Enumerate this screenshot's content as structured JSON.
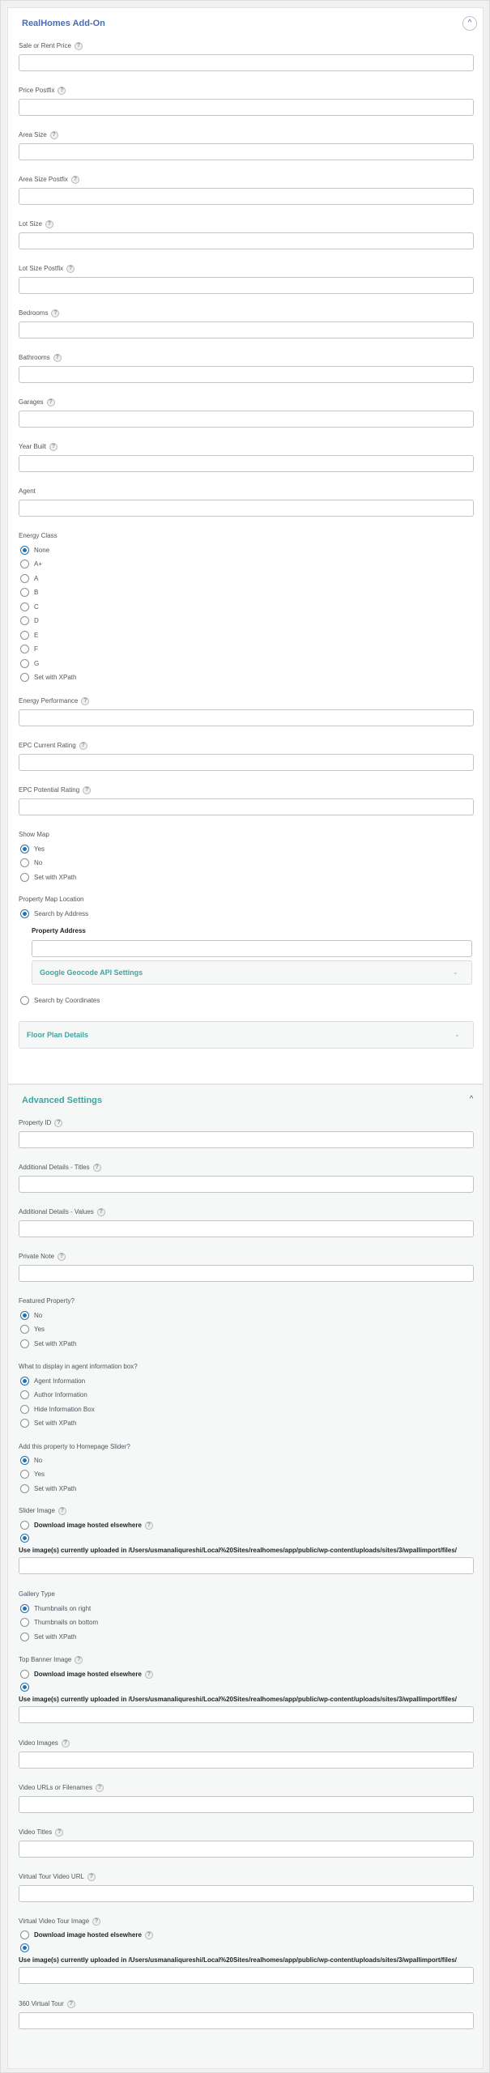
{
  "realhomes": {
    "title": "RealHomes Add-On",
    "fields": [
      {
        "label": "Sale or Rent Price"
      },
      {
        "label": "Price Postfix"
      },
      {
        "label": "Area Size"
      },
      {
        "label": "Area Size Postfix"
      },
      {
        "label": "Lot Size"
      },
      {
        "label": "Lot Size Postfix"
      },
      {
        "label": "Bedrooms"
      },
      {
        "label": "Bathrooms"
      },
      {
        "label": "Garages"
      },
      {
        "label": "Year Built"
      },
      {
        "label": "Agent"
      }
    ],
    "energy_class": {
      "label": "Energy Class",
      "options": [
        "None",
        "A+",
        "A",
        "B",
        "C",
        "D",
        "E",
        "F",
        "G",
        "Set with XPath"
      ],
      "selected": "None"
    },
    "fields2": [
      {
        "label": "Energy Performance"
      },
      {
        "label": "EPC Current Rating"
      },
      {
        "label": "EPC Potential Rating"
      }
    ],
    "show_map": {
      "label": "Show Map",
      "options": [
        "Yes",
        "No",
        "Set with XPath"
      ],
      "selected": "Yes"
    },
    "map_location": {
      "label": "Property Map Location",
      "opt_address": "Search by Address",
      "address_label": "Property Address",
      "geocode_title": "Google Geocode API Settings",
      "opt_coordinates": "Search by Coordinates",
      "selected": "Search by Address"
    },
    "floor_plan_title": "Floor Plan Details"
  },
  "advanced": {
    "title": "Advanced Settings",
    "fields": [
      {
        "label": "Property ID"
      },
      {
        "label": "Additional Details - Titles"
      },
      {
        "label": "Additional Details - Values"
      },
      {
        "label": "Private Note"
      }
    ],
    "featured": {
      "label": "Featured Property?",
      "options": [
        "No",
        "Yes",
        "Set with XPath"
      ],
      "selected": "No"
    },
    "agent_box": {
      "label": "What to display in agent information box?",
      "options": [
        "Agent Information",
        "Author Information",
        "Hide Information Box",
        "Set with XPath"
      ],
      "selected": "Agent Information"
    },
    "homepage_slider": {
      "label": "Add this property to Homepage Slider?",
      "options": [
        "No",
        "Yes",
        "Set with XPath"
      ],
      "selected": "No"
    },
    "slider_image": {
      "label": "Slider Image",
      "opt_download": "Download image hosted elsewhere",
      "opt_use": "Use image(s) currently uploaded in /Users/usmanaliqureshi/Local%20Sites/realhomes/app/public/wp-content/uploads/sites/3/wpallimport/files/"
    },
    "gallery_type": {
      "label": "Gallery Type",
      "options": [
        "Thumbnails on right",
        "Thumbnails on bottom",
        "Set with XPath"
      ],
      "selected": "Thumbnails on right"
    },
    "top_banner": {
      "label": "Top Banner Image",
      "opt_download": "Download image hosted elsewhere",
      "opt_use": "Use image(s) currently uploaded in /Users/usmanaliqureshi/Local%20Sites/realhomes/app/public/wp-content/uploads/sites/3/wpallimport/files/"
    },
    "fields2": [
      {
        "label": "Video Images"
      },
      {
        "label": "Video URLs or Filenames"
      },
      {
        "label": "Video Titles"
      },
      {
        "label": "Virtual Tour Video URL"
      }
    ],
    "virtual_tour_image": {
      "label": "Virtual Video Tour Image",
      "opt_download": "Download image hosted elsewhere",
      "opt_use": "Use image(s) currently uploaded in /Users/usmanaliqureshi/Local%20Sites/realhomes/app/public/wp-content/uploads/sites/3/wpallimport/files/"
    },
    "tour_360": {
      "label": "360 Virtual Tour"
    }
  },
  "icons": {
    "help": "?",
    "collapse": "^",
    "expand": "v"
  },
  "colors": {
    "title_blue": "#4a6bb5",
    "title_teal": "#3fa5a0",
    "radio_blue": "#2271b1"
  }
}
